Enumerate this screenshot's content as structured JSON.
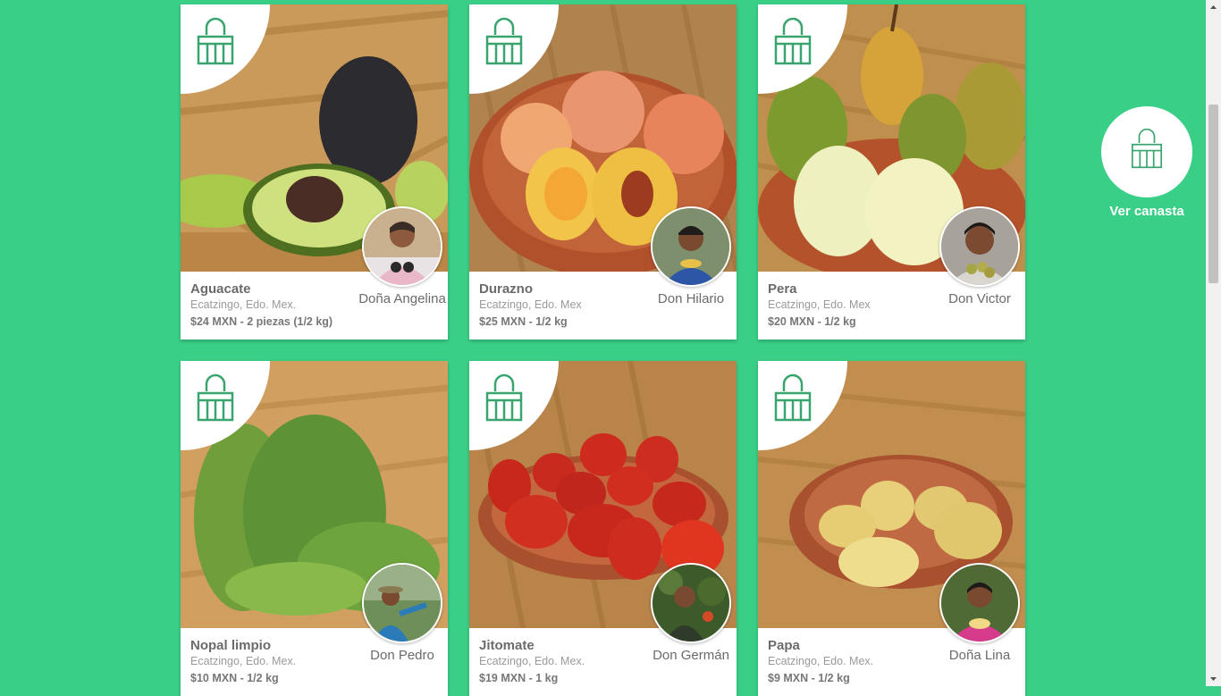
{
  "products": [
    {
      "name": "Aguacate",
      "location": "Ecatzingo, Edo. Mex.",
      "price": "$24 MXN - 2 piezas (1/2 kg)",
      "producer": "Doña Angelina",
      "photo": "avocado-photo"
    },
    {
      "name": "Durazno",
      "location": "Ecatzingo, Edo. Mex",
      "price": "$25 MXN - 1/2 kg",
      "producer": "Don Hilario",
      "photo": "peach-photo"
    },
    {
      "name": "Pera",
      "location": "Ecatzingo, Edo. Mex",
      "price": "$20 MXN - 1/2 kg",
      "producer": "Don Victor",
      "photo": "pear-photo"
    },
    {
      "name": "Nopal limpio",
      "location": "Ecatzingo, Edo. Mex.",
      "price": "$10 MXN - 1/2 kg",
      "producer": "Don Pedro",
      "photo": "cactus-photo"
    },
    {
      "name": "Jitomate",
      "location": "Ecatzingo, Edo. Mex.",
      "price": "$19 MXN - 1 kg",
      "producer": "Don Germán",
      "photo": "tomato-photo"
    },
    {
      "name": "Papa",
      "location": "Ecatzingo, Edo. Mex.",
      "price": "$9 MXN - 1/2 kg",
      "producer": "Doña Lina",
      "photo": "potato-photo"
    }
  ],
  "cart": {
    "label": "Ver canasta",
    "icon": "basket-icon"
  },
  "colors": {
    "background": "#3acf87",
    "accent": "#3aa46f"
  }
}
